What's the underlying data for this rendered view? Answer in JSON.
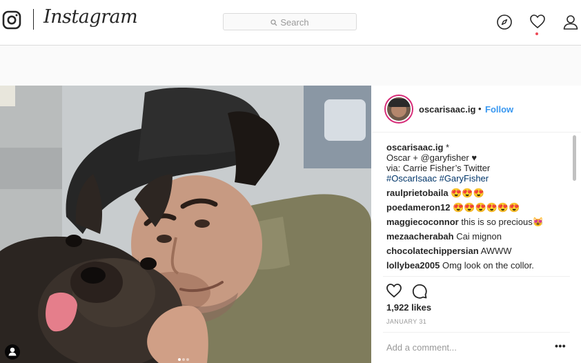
{
  "nav": {
    "brand": "Instagram",
    "search_placeholder": "Search",
    "icons": [
      "camera-icon",
      "compass-icon",
      "heart-icon",
      "person-icon"
    ]
  },
  "post": {
    "username": "oscarisaac.ig",
    "follow_separator": "•",
    "follow_label": "Follow",
    "caption": {
      "username": "oscarisaac.ig",
      "suffix": "*",
      "line1": "Oscar + @garyfisher ♥",
      "line2": "via: Carrie Fisher’s Twitter",
      "hashtags": "#OscarIsaac #GaryFisher"
    },
    "comments": [
      {
        "user": "raulprietobaila",
        "text": "😍😍😍"
      },
      {
        "user": "poedameron12",
        "text": "😍😍😍😍😍😍"
      },
      {
        "user": "maggiecoconnor",
        "text": "this is so precious😻"
      },
      {
        "user": "mezaacherabah",
        "text": "Cai mignon"
      },
      {
        "user": "chocolatechippersian",
        "text": "AWWW"
      },
      {
        "user": "lollybea2005",
        "text": "Omg look on the collor."
      }
    ],
    "likes": "1,922 likes",
    "date": "JANUARY 31",
    "add_comment_placeholder": "Add a comment...",
    "more_label": "•••",
    "carousel": {
      "count": 3,
      "active": 1
    }
  },
  "colors": {
    "accent": "#3897f0",
    "hashtag": "#003569",
    "notification": "#ed4956",
    "border": "#dbdbdb"
  }
}
